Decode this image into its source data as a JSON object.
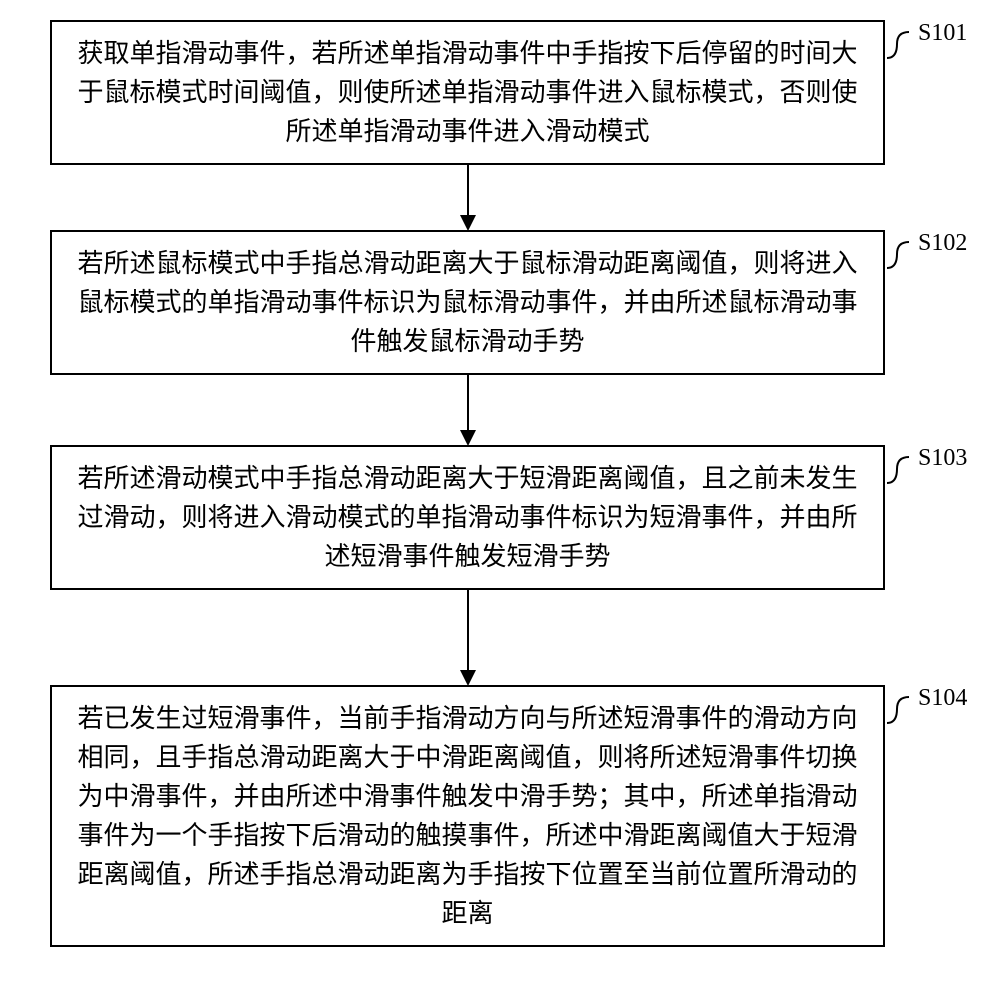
{
  "flowchart": {
    "steps": [
      {
        "id": "S101",
        "text": "获取单指滑动事件，若所述单指滑动事件中手指按下后停留的时间大于鼠标模式时间阈值，则使所述单指滑动事件进入鼠标模式，否则使所述单指滑动事件进入滑动模式"
      },
      {
        "id": "S102",
        "text": "若所述鼠标模式中手指总滑动距离大于鼠标滑动距离阈值，则将进入鼠标模式的单指滑动事件标识为鼠标滑动事件，并由所述鼠标滑动事件触发鼠标滑动手势"
      },
      {
        "id": "S103",
        "text": "若所述滑动模式中手指总滑动距离大于短滑距离阈值，且之前未发生过滑动，则将进入滑动模式的单指滑动事件标识为短滑事件，并由所述短滑事件触发短滑手势"
      },
      {
        "id": "S104",
        "text": "若已发生过短滑事件，当前手指滑动方向与所述短滑事件的滑动方向相同，且手指总滑动距离大于中滑距离阈值，则将所述短滑事件切换为中滑事件，并由所述中滑事件触发中滑手势；其中，所述单指滑动事件为一个手指按下后滑动的触摸事件，所述中滑距离阈值大于短滑距离阈值，所述手指总滑动距离为手指按下位置至当前位置所滑动的距离"
      }
    ]
  }
}
